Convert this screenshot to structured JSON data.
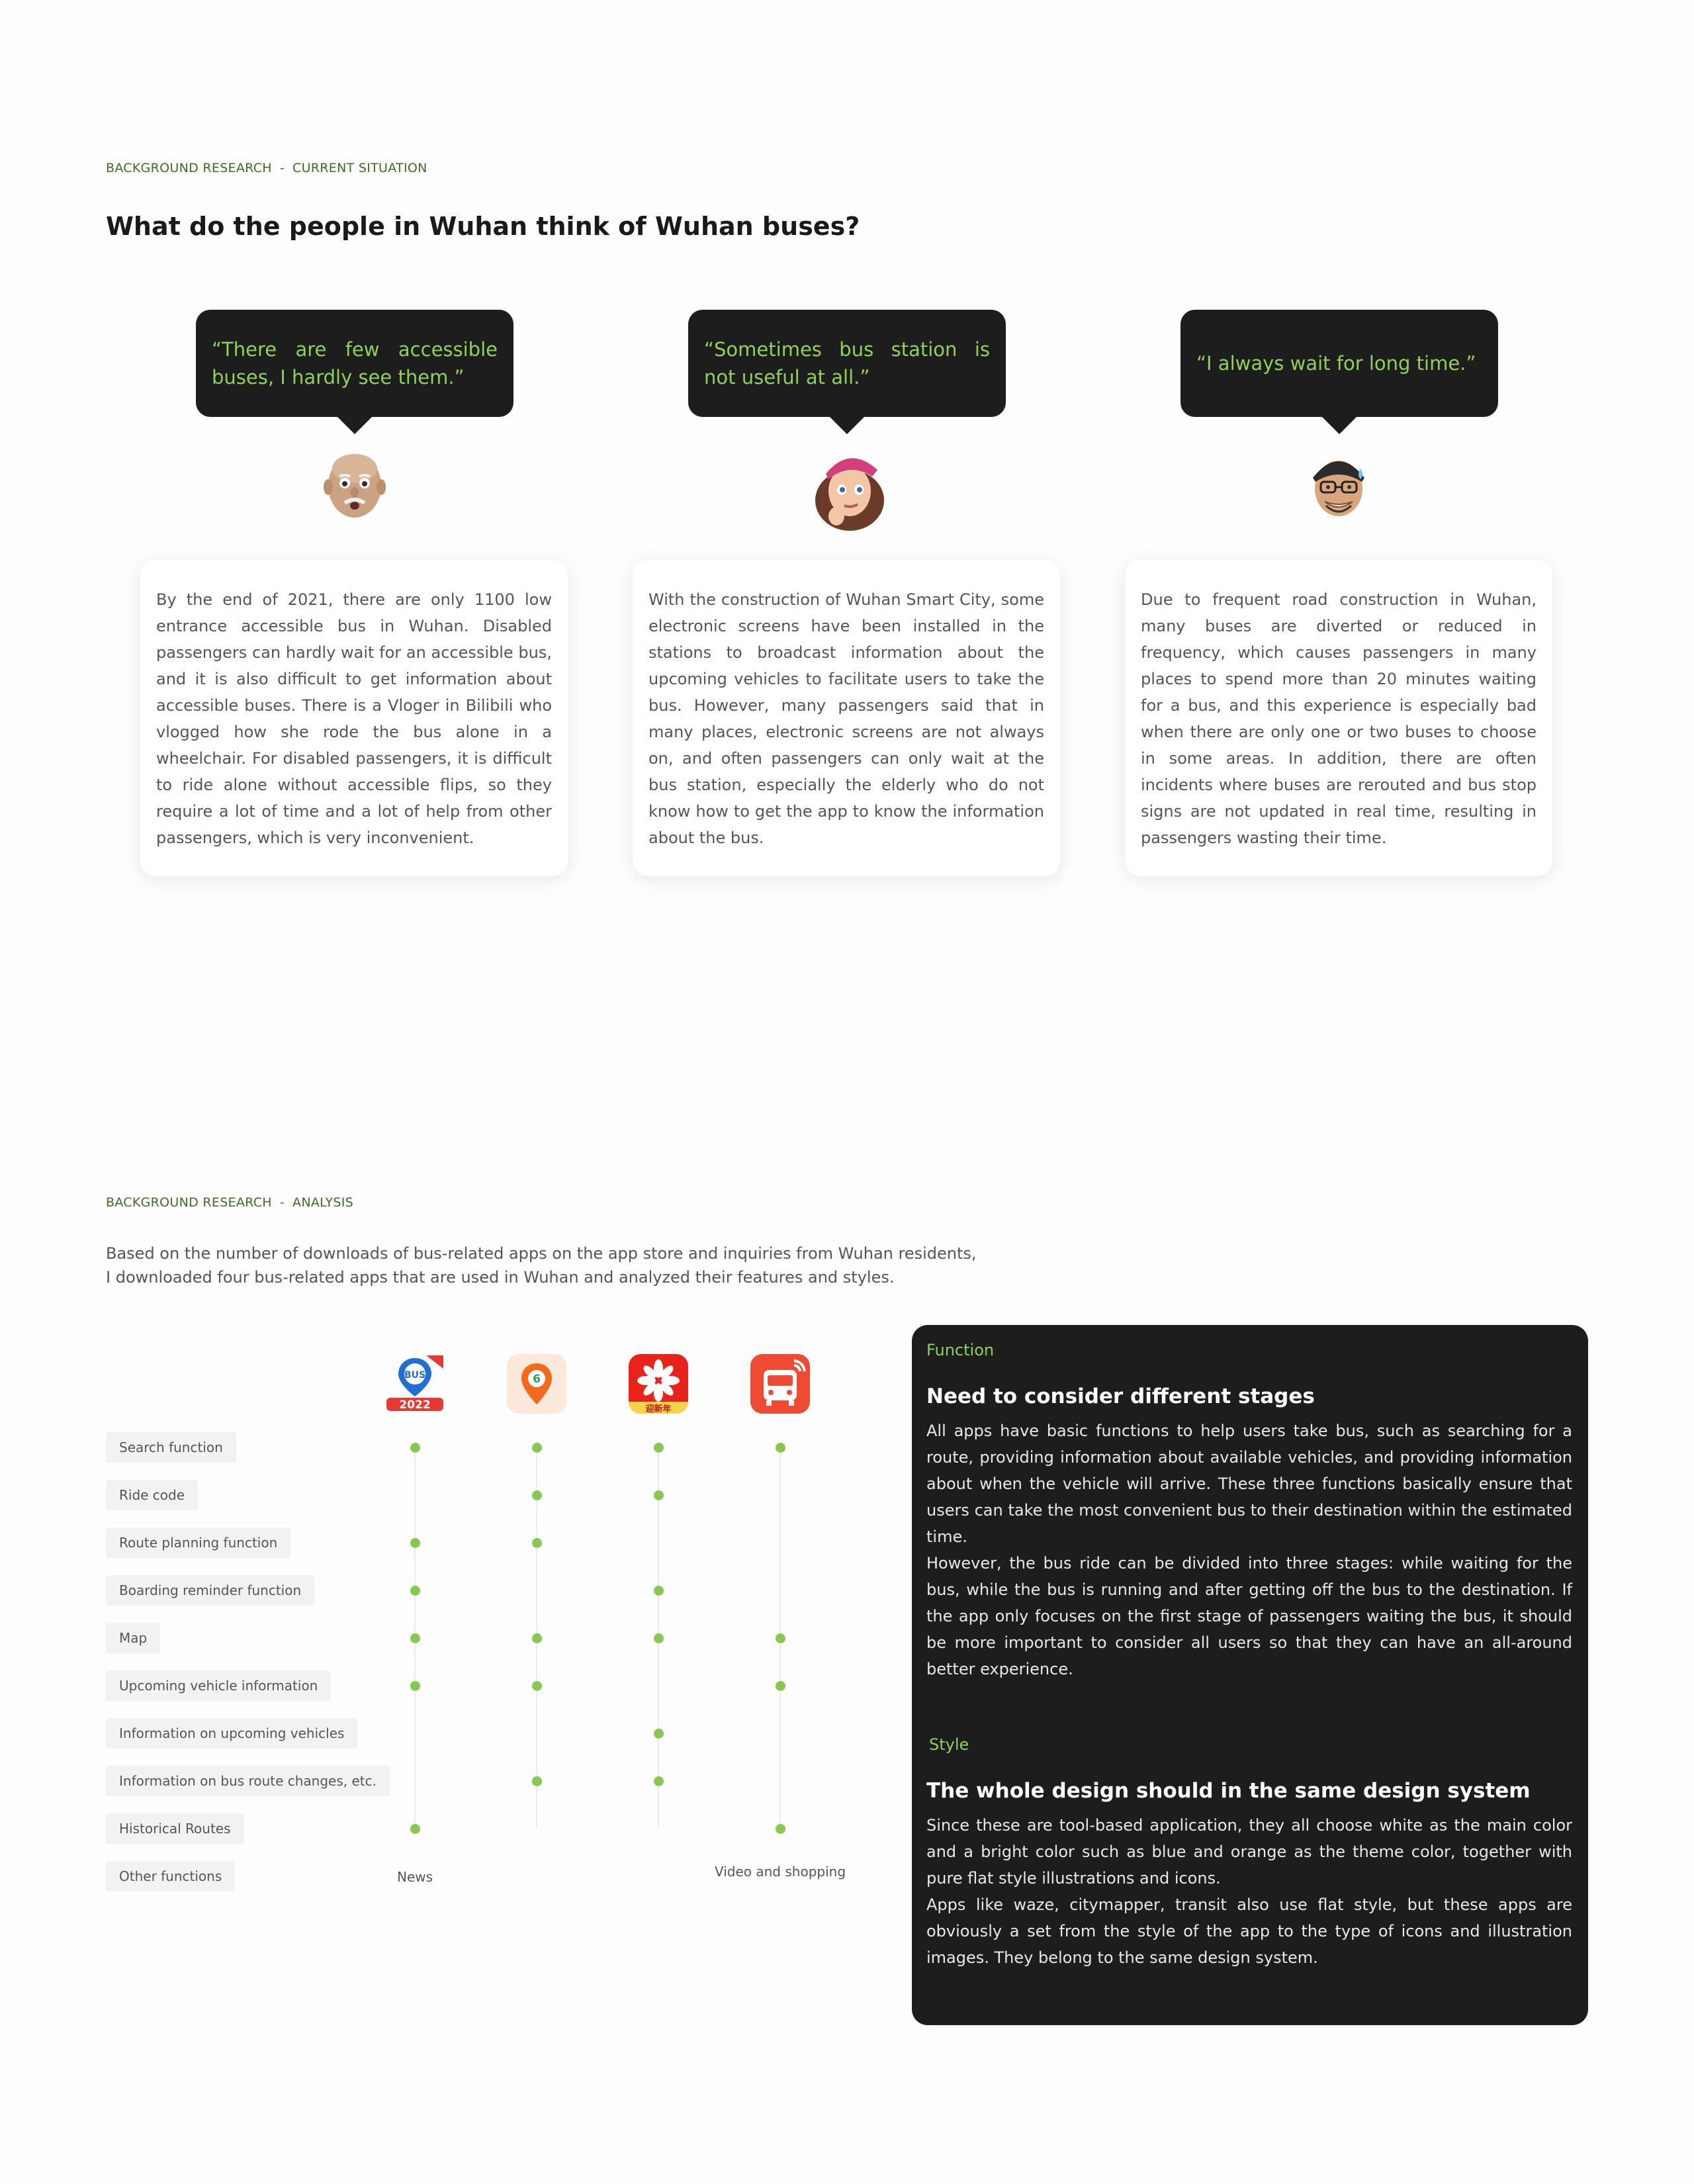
{
  "section1": {
    "eyebrow_left": "BACKGROUND RESEARCH",
    "eyebrow_sep": "-",
    "eyebrow_right": "CURRENT SITUATION",
    "title": "What do the people in Wuhan think of Wuhan buses?",
    "personas": [
      {
        "quote": "“There are few accessible buses, I hardly see them.”",
        "avatar": "elderly-man-avatar-icon",
        "text": "By the end of 2021, there are only 1100 low entrance accessible bus in Wuhan. Disabled passengers can hardly wait for an accessible bus, and it is also difficult to get information about accessible buses. There is a Vloger in Bilibili who vlogged how she rode the bus alone in a wheelchair. For disabled passengers, it is difficult to ride alone without accessible flips, so they require a lot of time and a lot of help from other passengers, which is very inconvenient."
      },
      {
        "quote": "“Sometimes bus station  is not useful at all.”",
        "avatar": "thinking-woman-avatar-icon",
        "text": "With the construction of Wuhan Smart City, some electronic screens have been installed in the stations to broadcast information about the upcoming vehicles to facilitate users to take the bus. However, many passengers said that in many places, electronic screens are not always on, and often passengers can only wait at the bus station, especially the elderly who do not know how to get the app to know the information about the bus."
      },
      {
        "quote": "“I always wait for long time.”",
        "avatar": "sweating-man-avatar-icon",
        "text": "Due to frequent road construction in Wuhan, many buses are diverted or reduced in frequency, which causes passengers in many places to spend more than 20 minutes waiting for a bus, and this experience is especially bad when there are only one or two buses to choose in some areas. In addition, there are often incidents where buses are rerouted and bus stop signs are not updated in real time, resulting in passengers wasting their time."
      }
    ]
  },
  "section2": {
    "eyebrow_left": "BACKGROUND RESEARCH",
    "eyebrow_sep": "-",
    "eyebrow_right": "ANALYSIS",
    "intro_line1": "Based on the number of downloads of bus-related apps on the app store and inquiries from Wuhan residents,",
    "intro_line2": "I downloaded four bus-related apps that are used in Wuhan and analyzed their features and styles.",
    "apps": [
      {
        "icon": "bus-2022-app-icon",
        "badge": "BUS",
        "year": "2022"
      },
      {
        "icon": "orange-location-pin-app-icon",
        "badge": "6"
      },
      {
        "icon": "red-flower-app-icon",
        "badge": "迎新年"
      },
      {
        "icon": "red-bus-app-icon"
      }
    ],
    "features": [
      "Search function",
      "Ride code",
      "Route planning function",
      "Boarding reminder function",
      "Map",
      "Upcoming vehicle information",
      "Information on upcoming vehicles",
      "Information on bus route changes, etc.",
      "Historical Routes",
      "Other functions"
    ],
    "matrix": [
      [
        true,
        true,
        true,
        true
      ],
      [
        false,
        true,
        true,
        false
      ],
      [
        true,
        true,
        false,
        false
      ],
      [
        true,
        false,
        true,
        false
      ],
      [
        true,
        true,
        true,
        true
      ],
      [
        true,
        true,
        false,
        true
      ],
      [
        false,
        false,
        true,
        false
      ],
      [
        false,
        true,
        true,
        false
      ],
      [
        true,
        false,
        false,
        true
      ]
    ],
    "other_notes": [
      "News",
      "",
      "",
      "Video and shopping"
    ],
    "colors": {
      "dot": "#86c851",
      "accent_green": "#8fd15a",
      "dark_panel": "#1d1d1d"
    }
  },
  "panel": {
    "function_tag": "Function",
    "function_title": "Need to consider different stages",
    "function_p1": "All apps have basic functions to help users take bus, such as searching for a route, providing information about available vehicles, and providing information about when the vehicle will arrive. These three functions basically ensure that users can take the most convenient bus to their destination within the estimated time.",
    "function_p2": "However, the bus ride can be divided into three stages: while waiting for the bus, while the bus is running and after getting off the bus to the destination. If the app only focuses on the first stage of passengers waiting the bus, it should be more important to consider all users so that they can have an all-around better experience.",
    "style_tag": "Style",
    "style_title": "The whole design should in the same design system",
    "style_p1": "Since these are tool-based application, they all choose white as the main color and a bright color such as blue and orange as the theme color, together with pure flat style illustrations and icons.",
    "style_p2": "Apps like waze, citymapper, transit also use flat style, but these apps are obviously a set from the style of the app to the type of icons and illustration images. They belong to the same design system."
  }
}
